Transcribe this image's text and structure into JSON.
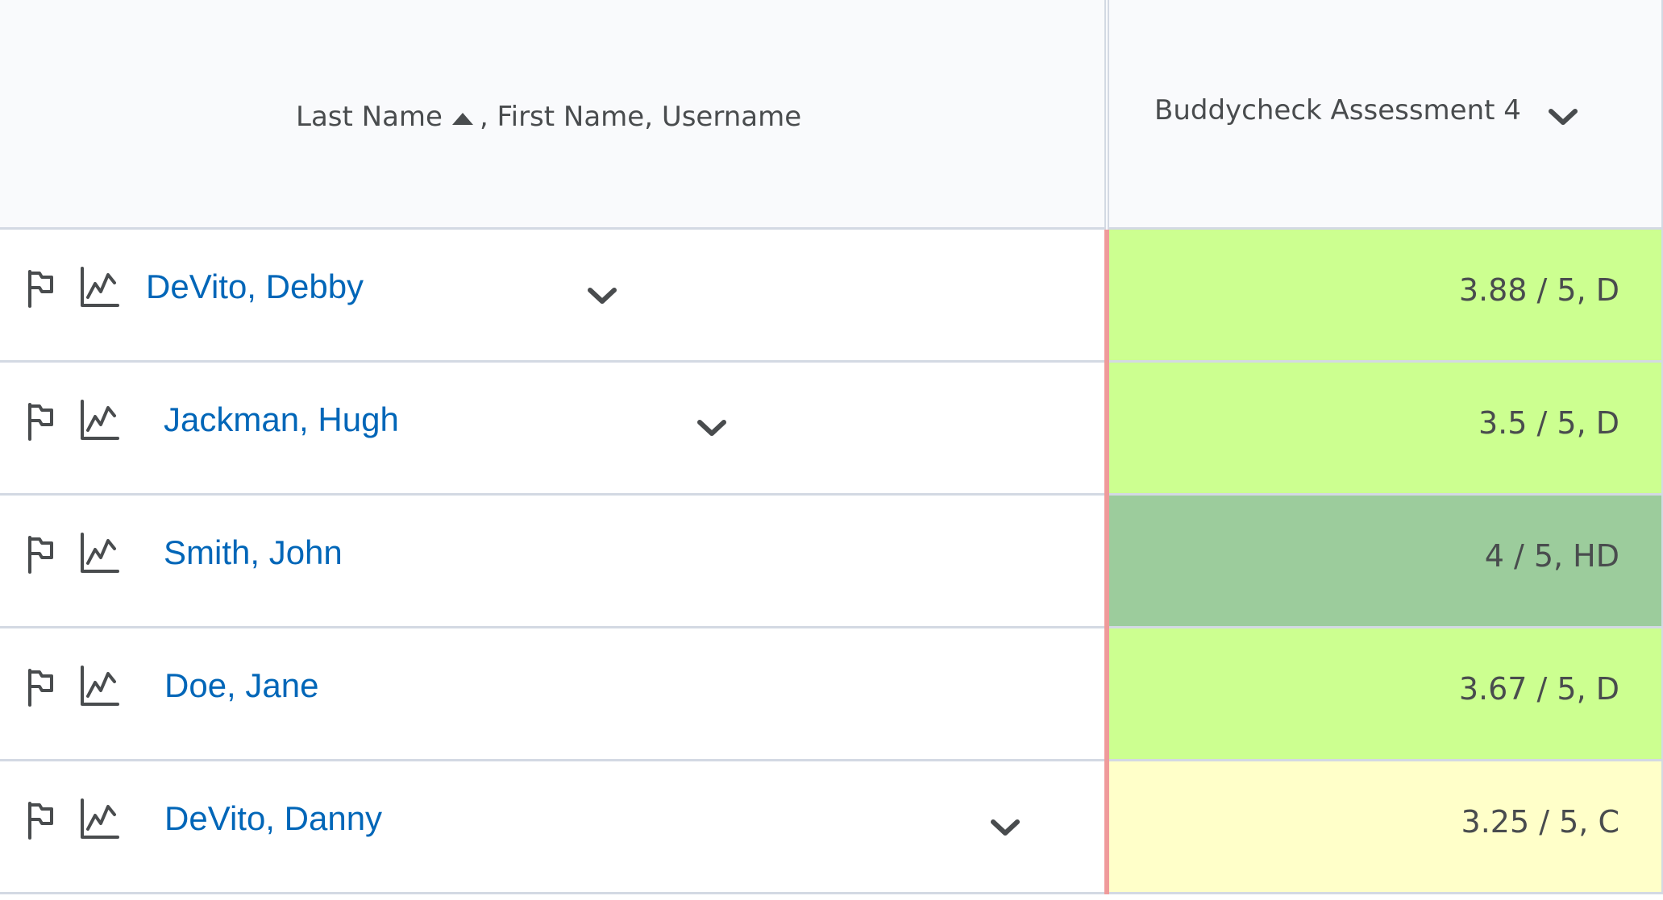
{
  "header": {
    "sort_label_primary": "Last Name",
    "sort_label_rest": ", First Name, Username",
    "column_title": "Buddycheck Assessment 4"
  },
  "colors": {
    "link": "#0066b8",
    "grade_d": "#ccff90",
    "grade_hd": "#9ccc9c",
    "grade_c": "#ffffc9",
    "row_marker": "#ef9a9a"
  },
  "icons": {
    "flag": "flag-icon",
    "stats": "stats-icon",
    "chevron": "chevron-down-icon",
    "sort": "sort-ascending-icon"
  },
  "rows": [
    {
      "name": "DeVito, Debby",
      "grade": "3.88 / 5, D"
    },
    {
      "name": "Jackman, Hugh",
      "grade": "3.5 / 5, D"
    },
    {
      "name": "Smith, John",
      "grade": "4 / 5, HD"
    },
    {
      "name": "Doe, Jane",
      "grade": "3.67 / 5, D"
    },
    {
      "name": "DeVito, Danny",
      "grade": "3.25 / 5, C"
    }
  ]
}
